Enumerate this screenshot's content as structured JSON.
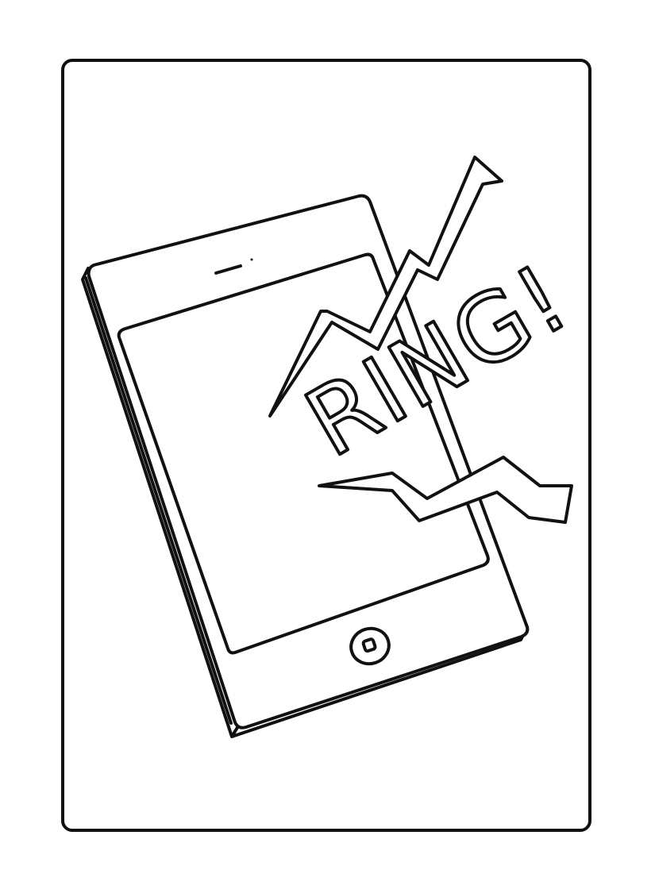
{
  "page": {
    "background_color": "#ffffff",
    "ink_color": "#111111"
  },
  "illustration": {
    "subject": "phone-icon",
    "sound_effect_text": "RING!",
    "effect": "lightning-bolt-icon"
  }
}
